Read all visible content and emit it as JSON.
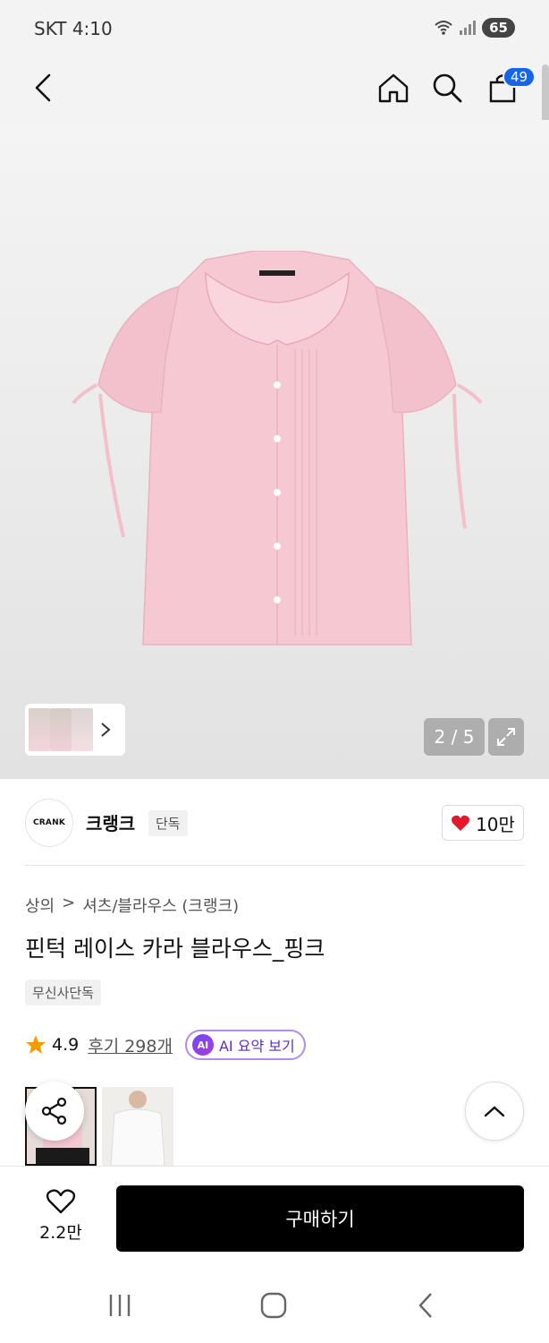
{
  "status_bar": {
    "carrier_time": "SKT 4:10",
    "battery": "65"
  },
  "nav": {
    "cart_count": "49"
  },
  "hero": {
    "counter": "2 / 5"
  },
  "brand": {
    "logo_text": "CRANK",
    "name": "크랭크",
    "badge": "단독",
    "likes": "10만"
  },
  "breadcrumb": {
    "category": "상의",
    "separator": ">",
    "subcategory": "셔츠/블라우스 (크랭크)"
  },
  "product": {
    "title": "핀턱 레이스 카라 블라우스_핑크",
    "tag": "무신사단독"
  },
  "rating": {
    "score": "4.9",
    "reviews": "후기 298개",
    "ai_icon": "AI",
    "ai_label": "AI 요약 보기"
  },
  "bottom_bar": {
    "wish_count": "2.2만",
    "buy_label": "구매하기"
  },
  "colors": {
    "accent_blue": "#1565e8",
    "heart_red": "#e5172d",
    "star_orange": "#f59b00",
    "ai_purple": "#5b2fc9"
  }
}
